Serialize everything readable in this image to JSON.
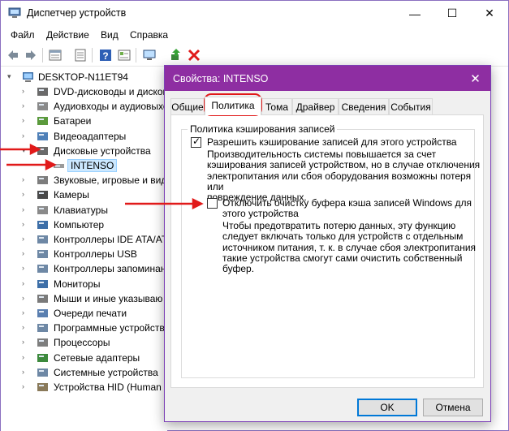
{
  "main_window": {
    "title": "Диспетчер устройств",
    "controls": {
      "minimize": "—",
      "maximize": "☐",
      "close": "✕"
    }
  },
  "menu": {
    "file": "Файл",
    "action": "Действие",
    "view": "Вид",
    "help": "Справка"
  },
  "toolbar": {
    "icons": [
      "back-arrow-icon",
      "forward-arrow-icon",
      "properties-icon",
      "list-icon",
      "help-icon",
      "view-icon",
      "monitor-icon",
      "update-driver-icon",
      "remove-device-icon"
    ],
    "remove_color": "#e11a1a"
  },
  "tree": {
    "root": "DESKTOP-N11ET94",
    "items": [
      {
        "label": "DVD-дисководы и дисково",
        "icon": "dvd-drive-icon"
      },
      {
        "label": "Аудиовходы и аудиовыхо",
        "icon": "audio-icon"
      },
      {
        "label": "Батареи",
        "icon": "battery-icon"
      },
      {
        "label": "Видеоадаптеры",
        "icon": "display-adapter-icon"
      },
      {
        "label": "Дисковые устройства",
        "icon": "disk-drive-icon"
      },
      {
        "label": "INTENSO",
        "icon": "disk-icon"
      },
      {
        "label": "Звуковые, игровые и вид",
        "icon": "sound-icon"
      },
      {
        "label": "Камеры",
        "icon": "camera-icon"
      },
      {
        "label": "Клавиатуры",
        "icon": "keyboard-icon"
      },
      {
        "label": "Компьютер",
        "icon": "computer-icon"
      },
      {
        "label": "Контроллеры IDE ATA/AT",
        "icon": "ide-controller-icon"
      },
      {
        "label": "Контроллеры USB",
        "icon": "usb-controller-icon"
      },
      {
        "label": "Контроллеры запоминан",
        "icon": "storage-controller-icon"
      },
      {
        "label": "Мониторы",
        "icon": "monitor-icon"
      },
      {
        "label": "Мыши и иные указываю",
        "icon": "mouse-icon"
      },
      {
        "label": "Очереди печати",
        "icon": "print-queue-icon"
      },
      {
        "label": "Программные устройства",
        "icon": "software-device-icon"
      },
      {
        "label": "Процессоры",
        "icon": "processor-icon"
      },
      {
        "label": "Сетевые адаптеры",
        "icon": "network-adapter-icon"
      },
      {
        "label": "Системные устройства",
        "icon": "system-device-icon"
      },
      {
        "label": "Устройства HID (Human I",
        "icon": "hid-icon"
      }
    ]
  },
  "dialog": {
    "title": "Свойства: INTENSO",
    "close": "✕",
    "tabs": [
      "Общие",
      "Политика",
      "Тома",
      "Драйвер",
      "Сведения",
      "События"
    ],
    "active_tab": "Политика",
    "group_title": "Политика кэширования записей",
    "option1": {
      "checked": true,
      "label": "Разрешить кэширование записей для этого устройства",
      "description": [
        "Производительность системы повышается за счет",
        "кэширования записей устройством, но в случае отключения",
        "электропитания или сбоя оборудования возможны потеря или",
        "повреждение данных."
      ]
    },
    "option2": {
      "checked": false,
      "label": [
        "Отключить очистку буфера кэша записей Windows для",
        "этого устройства"
      ],
      "description": [
        "Чтобы предотвратить потерю данных, эту функцию",
        "следует включать только для устройств с отдельным",
        "источником питания, т. к. в случае сбоя электропитания",
        "такие устройства смогут сами очистить собственный",
        "буфер."
      ]
    },
    "ok": "OK",
    "cancel": "Отмена"
  },
  "colors": {
    "dialog_titlebar": "#8e2ea2",
    "annotation_red": "#e11a1a",
    "selection": "#cce8ff"
  }
}
